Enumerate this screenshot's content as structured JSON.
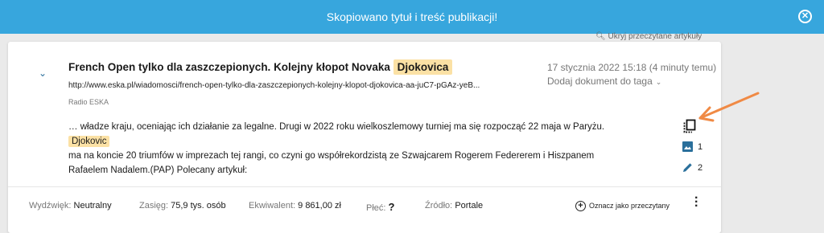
{
  "toast": {
    "message": "Skopiowano tytuł i treść publikacji!",
    "close_icon": "close-icon"
  },
  "search_hint": "Ukryj przeczytane artykuły",
  "article": {
    "title_prefix": "French Open tylko dla zaszczepionych. Kolejny kłopot Novaka",
    "title_highlight": "Djokovica",
    "url": "http://www.eska.pl/wiadomosci/french-open-tylko-dla-zaszczepionych-kolejny-klopot-djokovica-aa-juC7-pGAz-yeB...",
    "source": "Radio ESKA",
    "date": "17 stycznia 2022 15:18 (4 minuty temu)",
    "tag_dropdown_label": "Dodaj dokument do taga",
    "excerpt_before": "… władze kraju, oceniając ich działanie za legalne. Drugi w 2022 roku wielkoszlemowy turniej ma się rozpocząć 22 maja w Paryżu.",
    "excerpt_highlight": "Djokovic",
    "excerpt_after": "ma na koncie 20 triumfów w imprezach tej rangi, co czyni go współrekordzistą ze Szwajcarem Rogerem Federerem i Hiszpanem Rafaelem Nadalem.(PAP) Polecany artykuł:",
    "image_count": "1",
    "edit_count": "2"
  },
  "footer": {
    "department_label": "Wydźwięk:",
    "department_value": "Neutralny",
    "reach_label": "Zasięg:",
    "reach_value": "75,9 tys. osób",
    "equivalent_label": "Ekwiwalent:",
    "equivalent_value": "9 861,00 zł",
    "gender_label": "Płeć:",
    "gender_value": "?",
    "source_label": "Źródło:",
    "source_value": "Portale",
    "mark_read_label": "Oznacz jako przeczytany"
  },
  "colors": {
    "toast": "#37a6dd",
    "highlight": "#fbe1a5",
    "arrow": "#f08a45",
    "link": "#2a6f9b"
  }
}
